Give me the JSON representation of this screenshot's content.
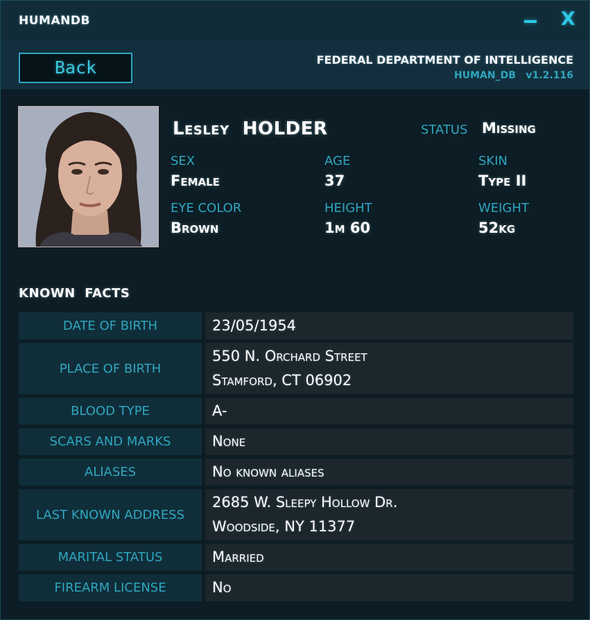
{
  "window": {
    "title": "HUMANDB",
    "minimize_icon": "minimize-icon",
    "close_label": "X"
  },
  "header": {
    "back_label": "Back",
    "agency": "FEDERAL DEPARTMENT OF INTELLIGENCE",
    "db_name": "HUMAN_DB",
    "version": "v1.2.116"
  },
  "profile": {
    "first_name": "Lesley",
    "last_name": "HOLDER",
    "status_label": "STATUS",
    "status_value": "Missing",
    "attributes": [
      {
        "label": "SEX",
        "value": "Female"
      },
      {
        "label": "AGE",
        "value": "37"
      },
      {
        "label": "SKIN",
        "value": "Type II"
      },
      {
        "label": "EYE COLOR",
        "value": "Brown"
      },
      {
        "label": "HEIGHT",
        "value": "1m 60"
      },
      {
        "label": "WEIGHT",
        "value": "52kg"
      }
    ]
  },
  "facts": {
    "title": "KNOWN  FACTS",
    "rows": [
      {
        "label": "DATE OF BIRTH",
        "lines": [
          "23/05/1954"
        ]
      },
      {
        "label": "PLACE OF BIRTH",
        "lines": [
          "550 N. Orchard Street",
          "Stamford, CT 06902"
        ]
      },
      {
        "label": "BLOOD TYPE",
        "lines": [
          "A-"
        ]
      },
      {
        "label": "SCARS AND MARKS",
        "lines": [
          "None"
        ]
      },
      {
        "label": "ALIASES",
        "lines": [
          "No known aliases"
        ]
      },
      {
        "label": "LAST KNOWN ADDRESS",
        "lines": [
          "2685 W. Sleepy Hollow Dr.",
          "Woodside, NY 11377"
        ]
      },
      {
        "label": "MARITAL STATUS",
        "lines": [
          "Married"
        ]
      },
      {
        "label": "FIREARM LICENSE",
        "lines": [
          "No"
        ]
      }
    ]
  },
  "colors": {
    "accent": "#2fa6bf",
    "background": "#0c1d25",
    "label_cell": "#102e3a",
    "value_cell": "#1b262d"
  }
}
